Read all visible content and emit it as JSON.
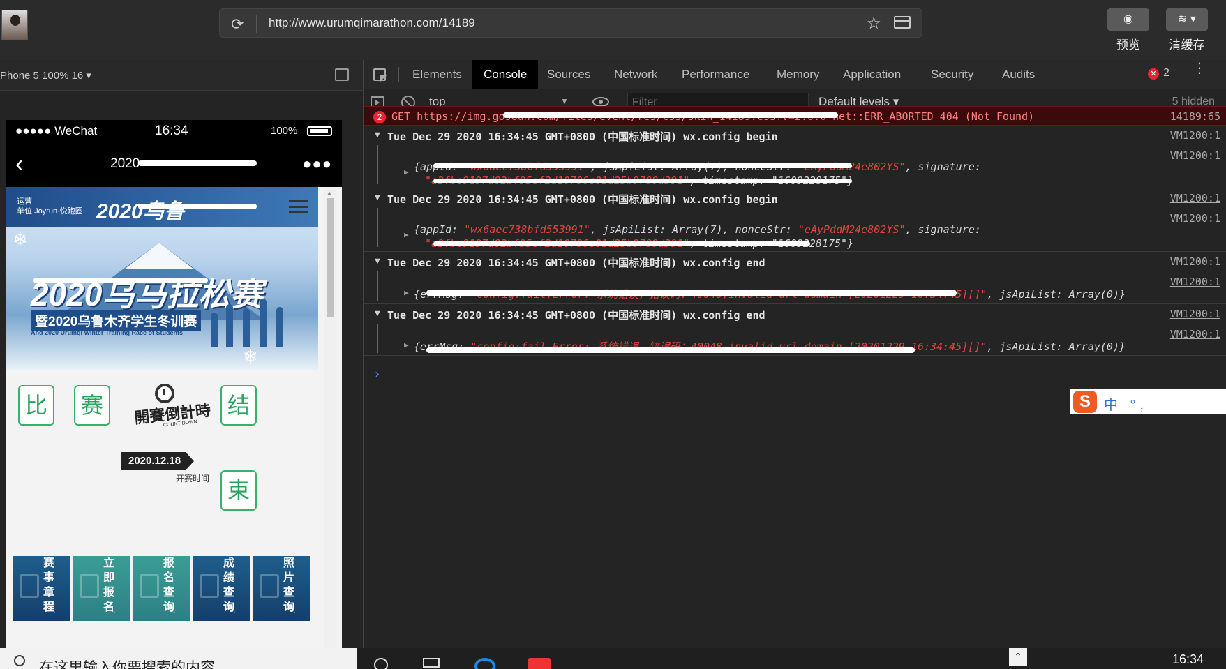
{
  "browser": {
    "url": "http://www.urumqimarathon.com/14189",
    "preview_label": "预览",
    "clear_cache_label": "清缓存"
  },
  "device_toolbar": {
    "device_info": "Phone 5  100%  16 ▾"
  },
  "phone": {
    "carrier": "●●●●● WeChat",
    "time": "16:34",
    "battery": "100%",
    "nav_title": "2020",
    "nav_more": "●●●",
    "banner": {
      "org_line1": "运营",
      "org_line2": "单位",
      "org_brand": "Joyrun·悦跑圈",
      "top_title": "2020乌鲁",
      "big_title": "2020乌马拉松赛",
      "subtitle": "暨2020乌鲁木齐学生冬训赛",
      "subtitle_en": "And 2020 Urumqi Winter Training Race of Students"
    },
    "tiles": [
      "比",
      "赛",
      "结",
      "束"
    ],
    "countdown_logo": "開賽倒計時",
    "countdown_logo_en": "COUNT DOWN",
    "countdown_date": "2020.12.18",
    "countdown_label": "开赛时间",
    "nav_tiles": [
      {
        "label": "赛事章程",
        "color": "blue"
      },
      {
        "label": "立即报名",
        "color": "teal"
      },
      {
        "label": "报名查询",
        "color": "teal"
      },
      {
        "label": "成绩查询",
        "color": "blue"
      },
      {
        "label": "照片查询",
        "color": "blue"
      }
    ]
  },
  "devtools": {
    "tabs": [
      "Elements",
      "Console",
      "Sources",
      "Network",
      "Performance",
      "Memory",
      "Application",
      "Security",
      "Audits"
    ],
    "active_tab": "Console",
    "error_count": "2",
    "context": "top",
    "filter_placeholder": "Filter",
    "levels": "Default levels ▾",
    "hidden": "5 hidden",
    "error_row": {
      "badge": "2",
      "text": "GET https://img.gosouh.com/files/event/res/css/skin_14189.css?v=2.0.0 net::ERR_ABORTED 404 (Not Found)",
      "source": "14189:65"
    },
    "groups": [
      {
        "title": "Tue Dec 29 2020 16:34:45 GMT+0800 (中国标准时间) wx.config begin",
        "source": "VM1200:1",
        "source2": "VM1200:1",
        "line1_prefix": "{appId: ",
        "line1_str": "\"wx6aec738bfd553991\"",
        "line1_mid": ", jsApiList: Array(7), nonceStr: ",
        "line1_str2": "\"eAyPddM24e802YS\"",
        "line1_end": ", signature:",
        "line2": "\"a2fbe9197d82bf95ef2d10706c01d25b9788d391\"",
        "line2_end": ", timestamp: \"1609228175\"}"
      },
      {
        "title": "Tue Dec 29 2020 16:34:45 GMT+0800 (中国标准时间) wx.config begin",
        "source": "VM1200:1",
        "source2": "VM1200:1",
        "line1_prefix": "{appId: ",
        "line1_str": "\"wx6aec738bfd553991\"",
        "line1_mid": ", jsApiList: Array(7), nonceStr: ",
        "line1_str2": "\"eAyPddM24e802YS\"",
        "line1_end": ", signature:",
        "line2": "\"a2fbe9197d82bf95ef2d10706c01d25b9788d391\"",
        "line2_end": ", timestamp: \"1609228175\"}"
      },
      {
        "title": "Tue Dec 29 2020 16:34:45 GMT+0800 (中国标准时间) wx.config end",
        "source": "VM1200:1",
        "source2": "VM1200:1",
        "line_prefix": "{errMsg: ",
        "line_str": "\"config:fail,Error: 系统错误，错误码：40048,invalid url domain [20201229 16:34:45][]\"",
        "line_end": ", jsApiList: Array(0)}"
      },
      {
        "title": "Tue Dec 29 2020 16:34:45 GMT+0800 (中国标准时间) wx.config end",
        "source": "VM1200:1",
        "source2": "VM1200:1",
        "line_prefix": "{errMsg: ",
        "line_str": "\"config:fail,Error: 系统错误，错误码：40048,invalid url domain [20201229 16:34:45][]\"",
        "line_end": ", jsApiList: Array(0)}"
      }
    ],
    "prompt": "›"
  },
  "ime": {
    "logo": "S",
    "text": "中 °,"
  },
  "taskbar": {
    "search_placeholder": "在这里输入你要搜索的内容",
    "clock": "16:34"
  }
}
